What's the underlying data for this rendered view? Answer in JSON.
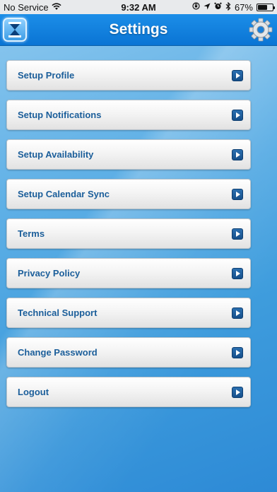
{
  "status_bar": {
    "carrier": "No Service",
    "time": "9:32 AM",
    "battery_percent": "67%",
    "battery_level": 0.67,
    "icons": [
      "wifi-icon",
      "orientation-lock-icon",
      "location-icon",
      "alarm-icon",
      "bluetooth-icon",
      "battery-icon"
    ]
  },
  "nav": {
    "title": "Settings",
    "left_icon": "hourglass-icon",
    "right_icon": "gear-icon"
  },
  "menu": {
    "items": [
      {
        "label": "Setup Profile"
      },
      {
        "label": "Setup Notifications"
      },
      {
        "label": "Setup Availability"
      },
      {
        "label": "Setup Calendar Sync"
      },
      {
        "label": "Terms"
      },
      {
        "label": "Privacy Policy"
      },
      {
        "label": "Technical Support"
      },
      {
        "label": "Change Password"
      },
      {
        "label": "Logout"
      }
    ]
  },
  "colors": {
    "nav_bar": "#0a74d4",
    "menu_text": "#1b5e9a",
    "chevron": "#164f8a",
    "background": "#3f9ddd"
  }
}
